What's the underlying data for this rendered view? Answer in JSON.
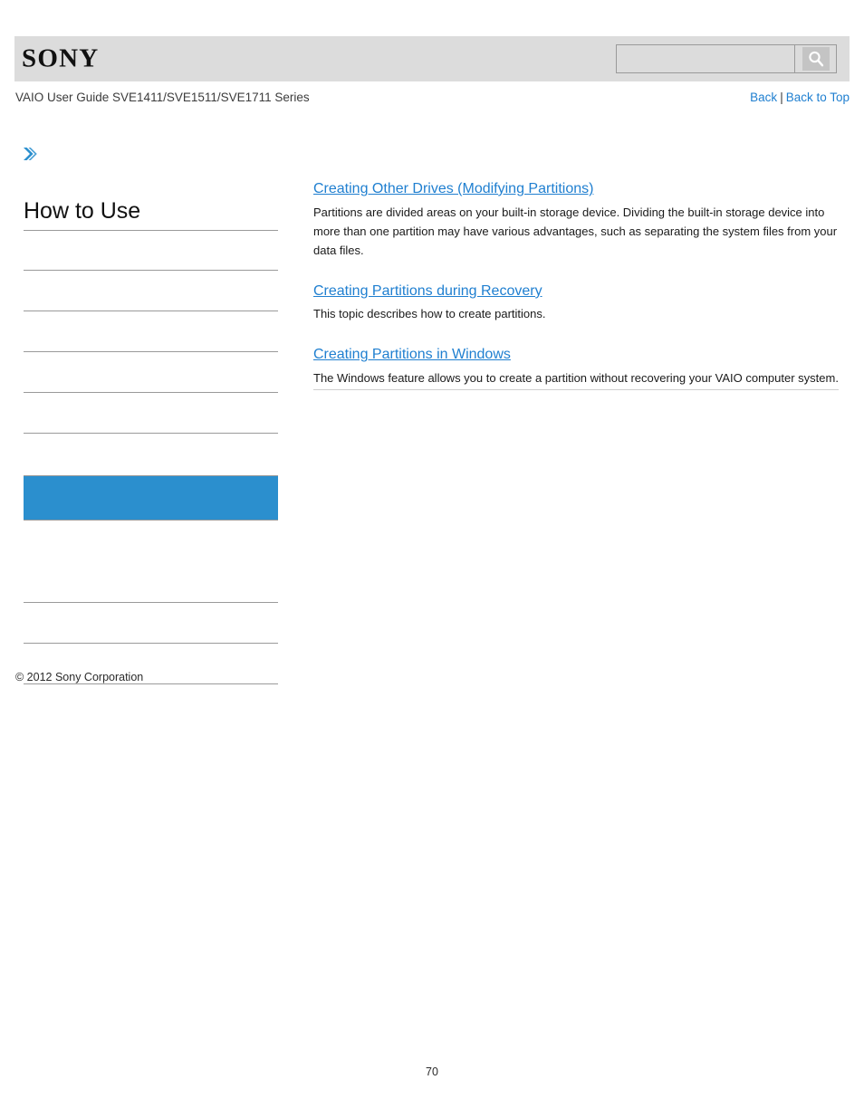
{
  "header": {
    "logo_text": "SONY",
    "search": {
      "value": "",
      "placeholder": "",
      "icon": "search-icon"
    }
  },
  "breadcrumb": {
    "title": "VAIO User Guide SVE1411/SVE1511/SVE1711 Series",
    "back_label": "Back",
    "separator": "|",
    "back_to_top_label": "Back to Top"
  },
  "sidebar": {
    "arrow_icon": "double-chevron-right-icon",
    "heading": "How to Use",
    "items": [
      {
        "label": "",
        "active": false
      },
      {
        "label": "",
        "active": false
      },
      {
        "label": "",
        "active": false
      },
      {
        "label": "",
        "active": false
      },
      {
        "label": "",
        "active": false
      },
      {
        "label": "",
        "active": false
      },
      {
        "label": "",
        "active": true
      },
      {
        "label": "",
        "active": false
      },
      {
        "label": "",
        "active": false
      },
      {
        "label": "",
        "active": false
      },
      {
        "label": "",
        "active": false
      }
    ]
  },
  "content": {
    "entries": [
      {
        "title": "Creating Other Drives (Modifying Partitions)",
        "description": "Partitions are divided areas on your built-in storage device. Dividing the built-in storage device into more than one partition may have various advantages, such as separating the system files from your data files."
      },
      {
        "title": "Creating Partitions during Recovery",
        "description": "This topic describes how to create partitions."
      },
      {
        "title": "Creating Partitions in Windows",
        "description": "The Windows feature allows you to create a partition without recovering your VAIO computer system."
      }
    ]
  },
  "footer": {
    "copyright": "© 2012 Sony Corporation",
    "page_number": "70"
  },
  "colors": {
    "link": "#1f7fd0",
    "highlight": "#2b8fce",
    "header_band": "#dcdcdc",
    "rule": "#9a9a9a"
  }
}
